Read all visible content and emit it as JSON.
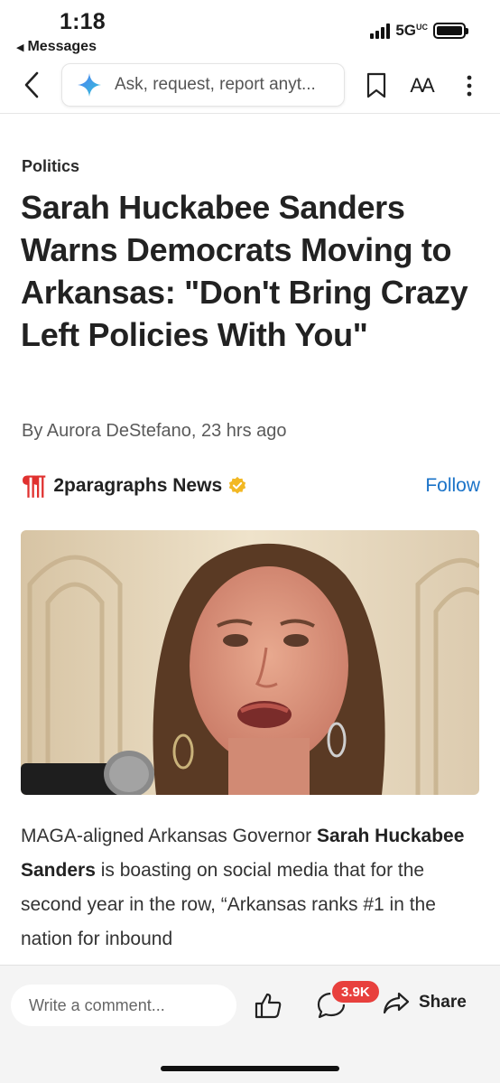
{
  "status_bar": {
    "time": "1:18",
    "back_app": "Messages",
    "network": "5G",
    "network_sup": "UC"
  },
  "nav": {
    "search_placeholder": "Ask, request, report anyt...",
    "icons": [
      "chevron-left-icon",
      "sparkle-icon",
      "bookmark-icon",
      "text-size-icon",
      "more-vertical-icon"
    ],
    "text_size_label": "AA"
  },
  "article": {
    "category": "Politics",
    "headline": "Sarah Huckabee Sanders Warns Democrats Moving to Arkansas: \"Don't Bring Crazy Left Policies With You\"",
    "byline": "By Aurora DeStefano,  23 hrs ago",
    "source": {
      "logo": "¶¶",
      "name": "2paragraphs News",
      "follow_label": "Follow"
    },
    "body": {
      "part1": "MAGA-aligned Arkansas Governor ",
      "bold": "Sarah Huckabee Sanders",
      "part2": " is boasting on social media that for the second year in the row, “Arkansas ranks #1 in the nation for inbound"
    }
  },
  "bottom_bar": {
    "comment_placeholder": "Write a comment...",
    "comment_count": "3.9K",
    "share_label": "Share"
  },
  "colors": {
    "accent_blue": "#1a73c8",
    "brand_red": "#e0312f",
    "badge_red": "#e8403d",
    "verified_gold": "#f2b824"
  }
}
